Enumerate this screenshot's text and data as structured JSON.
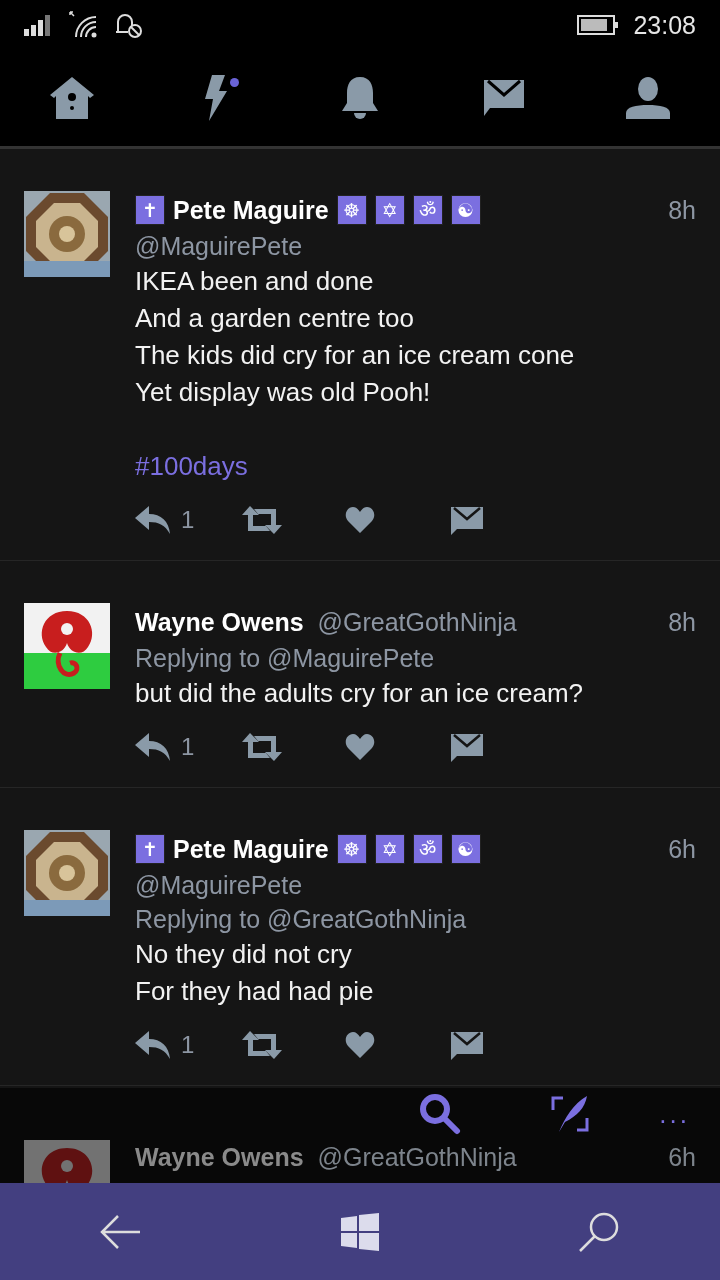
{
  "status_bar": {
    "time": "23:08"
  },
  "tabs": [
    {
      "dot": false
    },
    {
      "dot": true
    },
    {
      "dot": false
    },
    {
      "dot": false
    },
    {
      "dot": false
    }
  ],
  "tweets": [
    {
      "badges_before": [
        "✝"
      ],
      "name": "Pete Maguire",
      "badges_after": [
        "☸",
        "✡",
        "ॐ",
        "☯"
      ],
      "handle": "@MaguirePete",
      "handle_inline": false,
      "time": "8h",
      "lines": [
        "IKEA been and done",
        "And a garden centre too",
        "The kids did cry for an ice cream cone",
        "Yet display was old Pooh!"
      ],
      "hashtag": "#100days",
      "reply_count": "1"
    },
    {
      "name": "Wayne Owens",
      "handle": "@GreatGothNinja",
      "handle_inline": true,
      "time": "8h",
      "replying_to": "Replying to @MaguirePete",
      "lines": [
        "but did the adults cry for an ice cream?"
      ],
      "reply_count": "1"
    },
    {
      "badges_before": [
        "✝"
      ],
      "name": "Pete Maguire",
      "badges_after": [
        "☸",
        "✡",
        "ॐ",
        "☯"
      ],
      "handle": "@MaguirePete",
      "handle_inline": false,
      "time": "6h",
      "replying_to": "Replying to @GreatGothNinja",
      "lines": [
        "No they did not cry",
        "For they had had pie"
      ],
      "reply_count": "1"
    }
  ],
  "partial_tweet": {
    "name": "Wayne Owens",
    "handle": "@GreatGothNinja",
    "time": "6h"
  },
  "app_bar": {
    "more": "..."
  }
}
